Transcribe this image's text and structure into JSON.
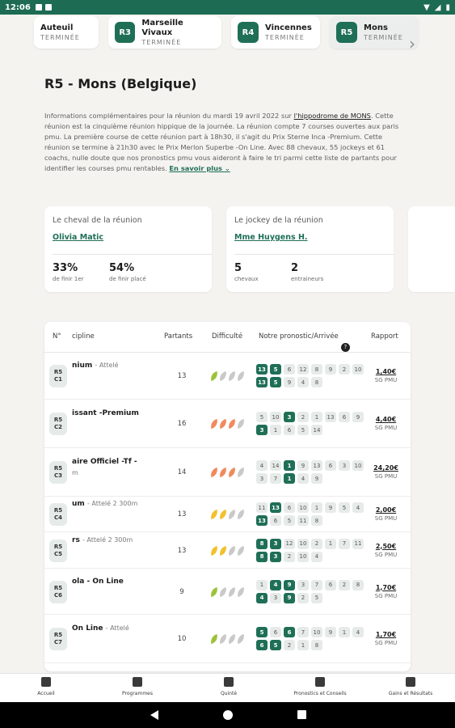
{
  "status": {
    "time": "12:06"
  },
  "tabs": [
    {
      "code": "",
      "name": "Auteuil",
      "status": "TERMINÉE"
    },
    {
      "code": "R3",
      "name": "Marseille Vivaux",
      "status": "TERMINÉE"
    },
    {
      "code": "R4",
      "name": "Vincennes",
      "status": "TERMINÉE"
    },
    {
      "code": "R5",
      "name": "Mons",
      "status": "TERMINÉE"
    }
  ],
  "page": {
    "title": "R5 - Mons (Belgique)",
    "desc_pre": "Informations complémentaires pour la réunion du mardi 19 avril 2022 sur ",
    "desc_link": "l'hippodrome de MONS",
    "desc_post": ". Cette réunion est la cinquième réunion hippique de la journée. La réunion compte 7 courses ouvertes aux paris pmu. La première course de cette réunion part à 18h30, il s'agit du Prix Sterne Inca -Premium. Cette réunion se termine à 21h30 avec le Prix Merlon Superbe -On Line. Avec 88 chevaux, 55 jockeys et 61 coachs, nulle doute que nos pronostics pmu vous aideront à faire le tri parmi cette liste de partants pour identifier les courses pmu rentables.",
    "more": "En savoir plus ⌄"
  },
  "cards": {
    "horse": {
      "heading": "Le cheval de la réunion",
      "name": "Olivia Matic",
      "stat1_value": "33%",
      "stat1_label": "de finir 1er",
      "stat2_value": "54%",
      "stat2_label": "de finir placé"
    },
    "jockey": {
      "heading": "Le jockey de la réunion",
      "name": "Mme Huygens H.",
      "stat1_value": "5",
      "stat1_label": "chevaux",
      "stat2_value": "2",
      "stat2_label": "entraineurs"
    }
  },
  "table": {
    "headers": {
      "no": "N°",
      "discipline": "cipline",
      "partants": "Partants",
      "difficulte": "Difficulté",
      "prono": "Notre pronostic/Arrivée",
      "rapport": "Rapport"
    },
    "rows": [
      {
        "r": "R5",
        "c": "C1",
        "name": "nium",
        "sub": "- Attelé",
        "sub2": "",
        "partants": "13",
        "diff": [
          "#9bc23a",
          "#c9c9c9",
          "#c9c9c9",
          "#c9c9c9"
        ],
        "prono": [
          [
            "13",
            "5",
            "6",
            "12",
            "8",
            "9",
            "2",
            "10"
          ],
          [
            "13",
            "5",
            "9",
            "4",
            "8"
          ]
        ],
        "hlp": [
          [
            0,
            1
          ],
          [
            0,
            1
          ]
        ],
        "amt": "1,40€",
        "pmu": "SG PMU"
      },
      {
        "r": "R5",
        "c": "C2",
        "name": "issant -Premium",
        "sub": "",
        "sub2": "",
        "partants": "16",
        "diff": [
          "#f08a5d",
          "#f08a5d",
          "#f08a5d",
          "#c9c9c9"
        ],
        "prono": [
          [
            "5",
            "10",
            "3",
            "2",
            "1",
            "13",
            "6",
            "9"
          ],
          [
            "3",
            "1",
            "6",
            "5",
            "14"
          ]
        ],
        "hlp": [
          [
            2
          ],
          [
            0
          ]
        ],
        "amt": "4,40€",
        "pmu": "SG PMU"
      },
      {
        "r": "R5",
        "c": "C3",
        "name": "aire Officiel -Tf -",
        "sub": "",
        "sub2": "m",
        "partants": "14",
        "diff": [
          "#f08a5d",
          "#f08a5d",
          "#f08a5d",
          "#c9c9c9"
        ],
        "prono": [
          [
            "4",
            "14",
            "1",
            "9",
            "13",
            "6",
            "3",
            "10"
          ],
          [
            "3",
            "7",
            "1",
            "4",
            "9"
          ]
        ],
        "hlp": [
          [
            2
          ],
          [
            2
          ]
        ],
        "amt": "24,20€",
        "pmu": "SG PMU"
      },
      {
        "r": "R5",
        "c": "C4",
        "name": "um",
        "sub": "- Attelé   2 300m",
        "sub2": "",
        "partants": "13",
        "diff": [
          "#f2c12e",
          "#f2c12e",
          "#c9c9c9",
          "#c9c9c9"
        ],
        "prono": [
          [
            "11",
            "13",
            "6",
            "10",
            "1",
            "9",
            "5",
            "4"
          ],
          [
            "13",
            "6",
            "5",
            "11",
            "8"
          ]
        ],
        "hlp": [
          [
            1
          ],
          [
            0
          ]
        ],
        "amt": "2,00€",
        "pmu": "SG PMU"
      },
      {
        "r": "R5",
        "c": "C5",
        "name": "rs",
        "sub": "- Attelé   2 300m",
        "sub2": "",
        "partants": "13",
        "diff": [
          "#f2c12e",
          "#f2c12e",
          "#c9c9c9",
          "#c9c9c9"
        ],
        "prono": [
          [
            "8",
            "3",
            "12",
            "10",
            "2",
            "1",
            "7",
            "11"
          ],
          [
            "8",
            "3",
            "2",
            "10",
            "4"
          ]
        ],
        "hlp": [
          [
            0,
            1
          ],
          [
            0,
            1
          ]
        ],
        "amt": "2,50€",
        "pmu": "SG PMU"
      },
      {
        "r": "R5",
        "c": "C6",
        "name": "ola - On Line",
        "sub": "",
        "sub2": "",
        "partants": "9",
        "diff": [
          "#9bc23a",
          "#c9c9c9",
          "#c9c9c9",
          "#c9c9c9"
        ],
        "prono": [
          [
            "1",
            "4",
            "9",
            "3",
            "7",
            "6",
            "2",
            "8"
          ],
          [
            "4",
            "3",
            "9",
            "2",
            "5"
          ]
        ],
        "hlp": [
          [
            1,
            2
          ],
          [
            0,
            2
          ]
        ],
        "amt": "1,70€",
        "pmu": "SG PMU"
      },
      {
        "r": "R5",
        "c": "C7",
        "name": "On Line",
        "sub": "- Attelé",
        "sub2": "",
        "partants": "10",
        "diff": [
          "#9bc23a",
          "#c9c9c9",
          "#c9c9c9",
          "#c9c9c9"
        ],
        "prono": [
          [
            "5",
            "6",
            "6",
            "7",
            "10",
            "9",
            "1",
            "4"
          ],
          [
            "6",
            "5",
            "2",
            "1",
            "8"
          ]
        ],
        "hlp": [
          [
            0,
            2
          ],
          [
            0,
            1
          ]
        ],
        "amt": "1,70€",
        "pmu": "SG PMU"
      }
    ]
  },
  "nav": [
    "Accueil",
    "Programmes",
    "Quinté",
    "Pronostics et Conseils",
    "Gains et Résultats"
  ]
}
